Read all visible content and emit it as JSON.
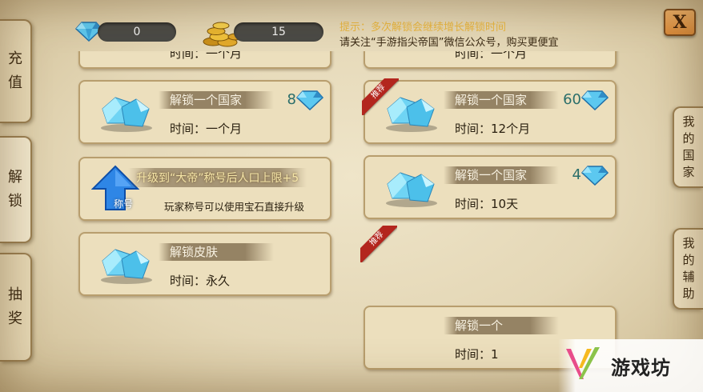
{
  "currency": {
    "gems": "0",
    "coins": "15"
  },
  "hint": {
    "line1": "提示：多次解锁会继续增长解锁时间",
    "line2": "请关注“手游指尖帝国”微信公众号，购买更便宜"
  },
  "close_label": "X",
  "left_tabs": [
    {
      "label": "充值",
      "chars": [
        "充",
        "值"
      ]
    },
    {
      "label": "解锁",
      "chars": [
        "解",
        "锁"
      ]
    },
    {
      "label": "抽奖",
      "chars": [
        "抽",
        "奖"
      ]
    }
  ],
  "right_tabs": [
    {
      "label": "我的国家",
      "chars": [
        "我",
        "的",
        "国",
        "家"
      ]
    },
    {
      "label": "我的辅助",
      "chars": [
        "我",
        "的",
        "辅",
        "助"
      ]
    }
  ],
  "cards_left": [
    {
      "name": "解锁一个国家",
      "time": "时间：一个月",
      "price": "8"
    },
    {
      "title": "升级到“大帝”称号后人口上限+5",
      "icon_label": "称号",
      "desc": "玩家称号可以使用宝石直接升级"
    },
    {
      "name": "解锁皮肤",
      "time": "时间：永久"
    }
  ],
  "cards_right": [
    {
      "name": "解锁一个国家",
      "time": "时间：12个月",
      "price": "60",
      "ribbon": "推荐"
    },
    {
      "name": "解锁一个国家",
      "time": "时间：10天",
      "price": "4"
    },
    {
      "ribbon": "推荐"
    },
    {
      "name": "解锁一个",
      "time": "时间：1"
    }
  ],
  "partial_top": {
    "left_time": "时间：一个月",
    "right_time": "时间：一个月"
  },
  "watermark": "游戏坊",
  "colors": {
    "parchment": "#e3d6b6",
    "ribbon": "#b3261e",
    "price": "#2a6e6a",
    "hint": "#e8b640"
  },
  "icons": [
    "diamond-icon",
    "gold-coins-icon",
    "blue-up-arrow-icon",
    "gem-pile-icon"
  ]
}
